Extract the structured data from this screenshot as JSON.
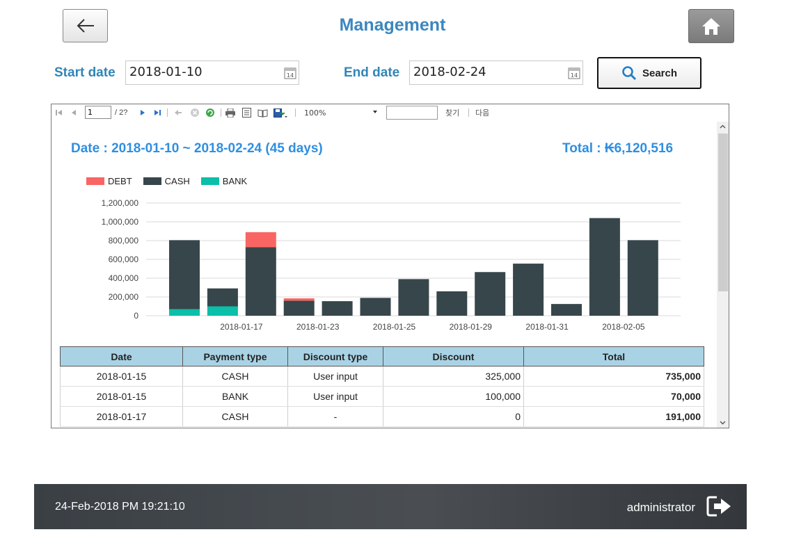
{
  "header": {
    "title": "Management"
  },
  "search": {
    "start_label": "Start date",
    "start_value": "2018-01-10",
    "end_label": "End date",
    "end_value": "2018-02-24",
    "button_label": "Search"
  },
  "toolbar": {
    "page_current": "1",
    "page_total": "/ 2?",
    "zoom": "100%",
    "find_label": "찾기",
    "next_label": "다음"
  },
  "report": {
    "date_range": "Date : 2018-01-10 ~ 2018-02-24 (45 days)",
    "total": "Total : ₭6,120,516"
  },
  "chart_data": {
    "type": "bar",
    "stacked": true,
    "legend_position": "top-left",
    "grid": true,
    "ylim": [
      0,
      1200000
    ],
    "yticks": [
      "1,200,000",
      "1,000,000",
      "800,000",
      "600,000",
      "400,000",
      "200,000",
      "0"
    ],
    "yticks_values": [
      1200000,
      1000000,
      800000,
      600000,
      400000,
      200000,
      0
    ],
    "x_tick_labels": [
      "",
      "2018-01-17",
      "",
      "2018-01-23",
      "",
      "2018-01-25",
      "",
      "2018-01-29",
      "",
      "2018-01-31",
      "",
      "2018-02-05",
      ""
    ],
    "series": [
      {
        "name": "BANK",
        "color": "#0bbfa8",
        "values": [
          70000,
          100000,
          0,
          0,
          0,
          0,
          0,
          0,
          0,
          0,
          0,
          0,
          0
        ]
      },
      {
        "name": "CASH",
        "color": "#37464b",
        "values": [
          735000,
          191000,
          730000,
          160000,
          155000,
          190000,
          390000,
          260000,
          465000,
          555000,
          125000,
          1040000,
          805000
        ]
      },
      {
        "name": "DEBT",
        "color": "#f96563",
        "values": [
          0,
          0,
          160000,
          25000,
          0,
          0,
          0,
          0,
          0,
          0,
          0,
          0,
          0
        ]
      }
    ],
    "legend_order": [
      "DEBT",
      "CASH",
      "BANK"
    ]
  },
  "table": {
    "headers": [
      "Date",
      "Payment type",
      "Discount type",
      "Discount",
      "Total"
    ],
    "rows": [
      [
        "2018-01-15",
        "CASH",
        "User input",
        "325,000",
        "735,000"
      ],
      [
        "2018-01-15",
        "BANK",
        "User input",
        "100,000",
        "70,000"
      ],
      [
        "2018-01-17",
        "CASH",
        "-",
        "0",
        "191,000"
      ]
    ]
  },
  "footer": {
    "datetime": "24-Feb-2018 PM 19:21:10",
    "user": "administrator"
  }
}
